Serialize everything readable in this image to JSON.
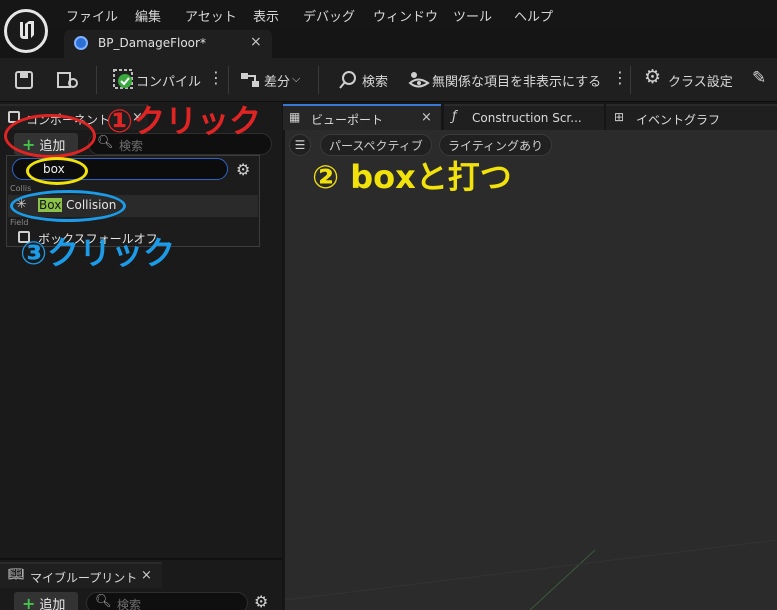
{
  "menu": [
    "ファイル",
    "編集",
    "アセット",
    "表示",
    "デバッグ",
    "ウィンドウ",
    "ツール",
    "ヘルプ"
  ],
  "doc_tab": {
    "label": "BP_DamageFloor*",
    "close": "×"
  },
  "toolbar": {
    "compile": "コンパイル",
    "diff": "差分",
    "search": "検索",
    "hide_unrelated": "無関係な項目を非表示にする",
    "class_settings": "クラス設定"
  },
  "components_panel": {
    "tab_label": "コンポーネント",
    "close": "×",
    "add_label": "追加",
    "search_placeholder": "検索"
  },
  "dropdown": {
    "search_value": "box",
    "categories": [
      "Collis",
      "Field"
    ],
    "items": [
      {
        "highlight": "Box",
        "rest": " Collision"
      },
      {
        "label": "ボックスフォールオフ"
      }
    ]
  },
  "viewport_tabs": [
    {
      "label": "ビューポート",
      "close": "×"
    },
    {
      "label": "Construction Scr..."
    },
    {
      "label": "イベントグラフ"
    }
  ],
  "viewport": {
    "perspective": "パースペクティブ",
    "lighting": "ライティングあり"
  },
  "my_blueprint": {
    "tab_label": "マイブループリント",
    "close": "×",
    "add_label": "追加",
    "search_placeholder": "検索"
  },
  "annotations": {
    "step1": "①クリック",
    "step2": "② boxと打つ",
    "step3": "③クリック"
  },
  "colors": {
    "red": "#e02424",
    "yellow": "#f2e20c",
    "blue": "#1c9be8",
    "accent_green": "#46c24a"
  }
}
